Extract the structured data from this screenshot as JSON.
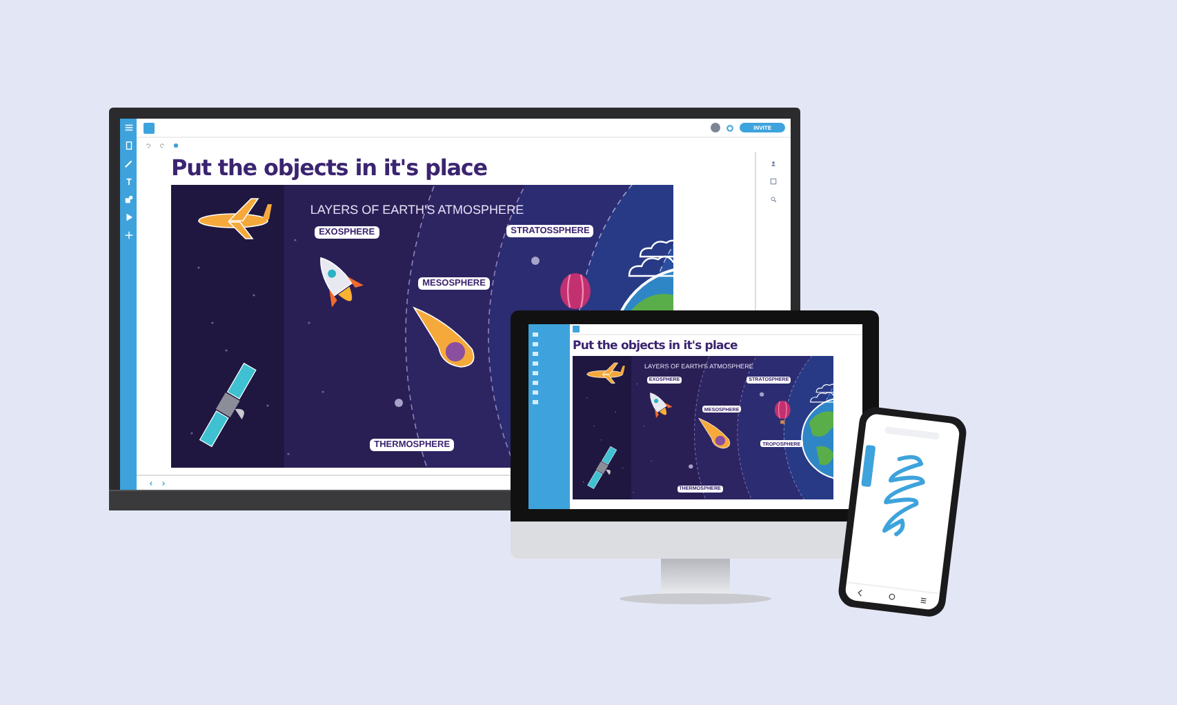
{
  "devices": [
    {
      "kind": "monitor",
      "invite_button": "INVITE",
      "page_title": "Put the objects in it's place",
      "slide": {
        "title": "LAYERS OF EARTH'S ATMOSPHERE",
        "labels": [
          "EXOSPHERE",
          "MESOSPHERE",
          "STRATOSSPHERE",
          "THERMOSPHERE"
        ]
      }
    },
    {
      "kind": "desktop",
      "page_title": "Put the objects in it's place",
      "slide": {
        "title": "LAYERS OF EARTH'S ATMOSPHERE",
        "labels": [
          "EXOSPHERE",
          "MESOSPHERE",
          "STRATOSPHERE",
          "TROPOSPHERE",
          "THERMOSPHERE"
        ]
      }
    },
    {
      "kind": "phone"
    }
  ]
}
